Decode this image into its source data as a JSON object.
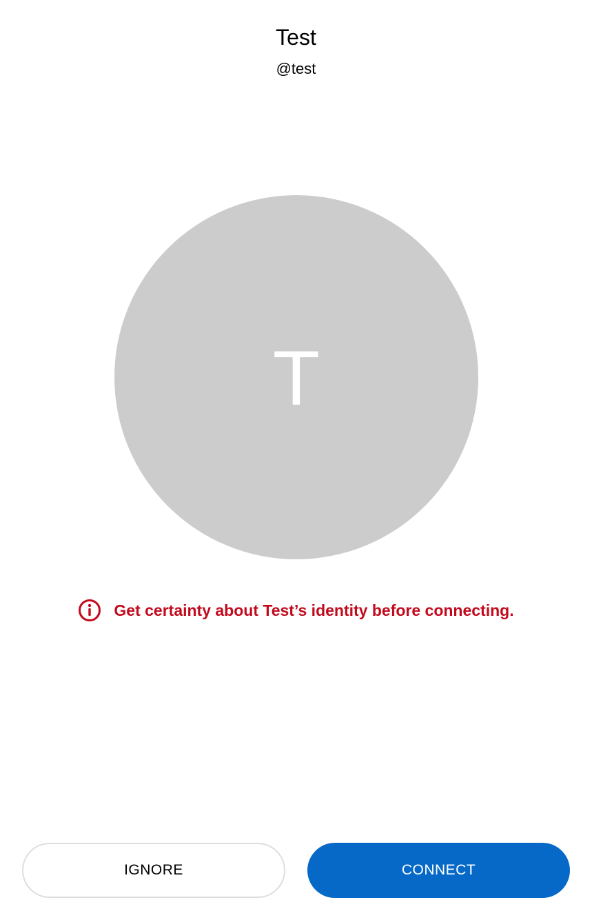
{
  "profile": {
    "name": "Test",
    "handle": "@test",
    "avatar_initial": "T",
    "avatar_color": "#cccccc"
  },
  "warning": {
    "icon": "info-circle-icon",
    "text": "Get certainty about Test’s identity before connecting.",
    "color": "#c20a1d"
  },
  "actions": {
    "ignore_label": "IGNORE",
    "connect_label": "CONNECT",
    "connect_color": "#0669c8"
  }
}
